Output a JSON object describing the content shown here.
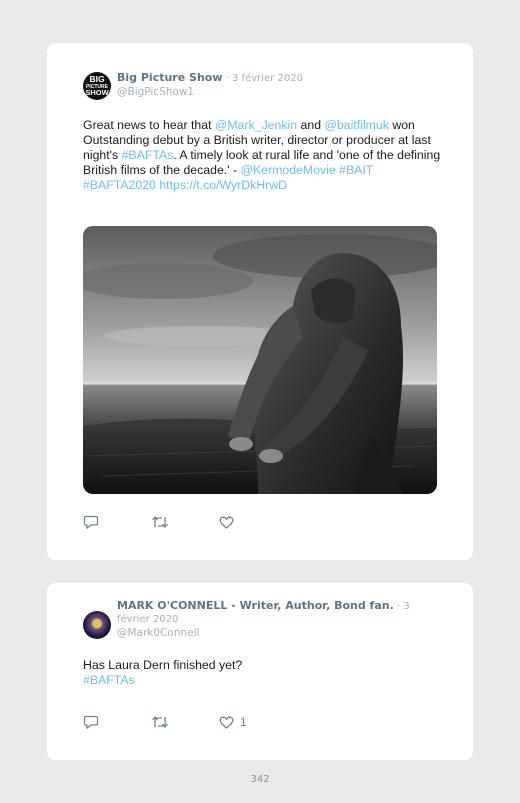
{
  "tweets": [
    {
      "avatar_lines": [
        "BIG",
        "PICTURE",
        "SHOW"
      ],
      "display_name": "Big Picture Show",
      "separator": " · ",
      "date": "3 février 2020",
      "handle": "@BigPicShow1",
      "text_parts": [
        {
          "t": "Great news to hear that ",
          "link": false
        },
        {
          "t": "@Mark_Jenkin",
          "link": true
        },
        {
          "t": " and ",
          "link": false
        },
        {
          "t": "@baitfilmuk",
          "link": true
        },
        {
          "t": " won Outstanding debut by a British writer, director or producer at last night's ",
          "link": false
        },
        {
          "t": "#BAFTAs",
          "link": true
        },
        {
          "t": ". A timely look at rural life and 'one of the defining British films of the decade.' - ",
          "link": false
        },
        {
          "t": "@KermodeMovie",
          "link": true
        },
        {
          "t": " ",
          "link": false
        },
        {
          "t": "#BAIT",
          "link": true
        },
        {
          "t": " ",
          "link": false
        },
        {
          "t": "#BAFTA2020",
          "link": true
        },
        {
          "t": " ",
          "link": false
        },
        {
          "t": "https://t.co/WyrDkHrwD",
          "link": true
        }
      ],
      "actions": {
        "reply_icon": "reply-icon",
        "retweet_icon": "retweet-icon",
        "like_icon": "heart-icon",
        "like_count": ""
      }
    },
    {
      "display_name": "MARK O'CONNELL - Writer, Author, Bond fan.",
      "separator": " · ",
      "date": "3 février 2020",
      "handle": "@Mark0Connell",
      "text_parts": [
        {
          "t": "Has Laura Dern finished yet?",
          "link": false
        },
        {
          "t": "#BAFTAs",
          "link": true
        }
      ],
      "actions": {
        "reply_icon": "reply-icon",
        "retweet_icon": "retweet-icon",
        "like_icon": "heart-icon",
        "like_count": "1"
      }
    }
  ],
  "page_number": "342",
  "colors": {
    "link": "#6cc1e6",
    "name": "#607486",
    "muted": "#a8b2bb",
    "background": "#e9e9e9"
  }
}
